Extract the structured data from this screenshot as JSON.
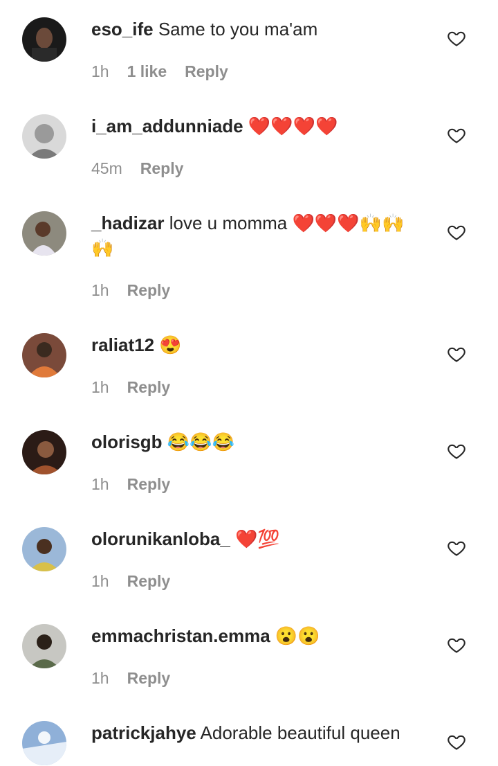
{
  "comments": [
    {
      "username": "eso_ife",
      "text": "Same to you ma'am",
      "time": "1h",
      "likes": "1 like",
      "reply": "Reply",
      "avatar": "avatar-1"
    },
    {
      "username": "i_am_addunniade",
      "text": "❤️❤️❤️❤️",
      "time": "45m",
      "reply": "Reply",
      "avatar": "avatar-2"
    },
    {
      "username": "_hadizar",
      "text": "love u momma ❤️❤️❤️🙌🙌🙌",
      "time": "1h",
      "reply": "Reply",
      "avatar": "avatar-3"
    },
    {
      "username": "raliat12",
      "text": "😍",
      "time": "1h",
      "reply": "Reply",
      "avatar": "avatar-4"
    },
    {
      "username": "olorisgb",
      "text": "😂😂😂",
      "time": "1h",
      "reply": "Reply",
      "avatar": "avatar-5"
    },
    {
      "username": "olorunikanloba_",
      "text": "❤️💯",
      "time": "1h",
      "reply": "Reply",
      "avatar": "avatar-6"
    },
    {
      "username": "emmachristan.emma",
      "text": "😮😮",
      "time": "1h",
      "reply": "Reply",
      "avatar": "avatar-7"
    },
    {
      "username": "patrickjahye",
      "text": "Adorable beautiful queen",
      "avatar": "avatar-8"
    }
  ],
  "icons": {
    "like": "heart-outline-icon"
  },
  "colors": {
    "text": "#262626",
    "meta": "#8e8e8e",
    "background": "#ffffff"
  }
}
